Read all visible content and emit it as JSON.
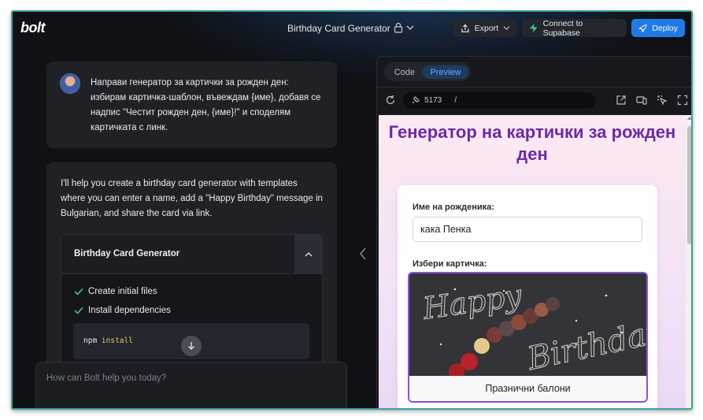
{
  "app": {
    "logo": "bolt",
    "project_title": "Birthday Card Generator"
  },
  "toolbar": {
    "export_label": "Export",
    "supabase_label": "Connect to Supabase",
    "deploy_label": "Deploy"
  },
  "chat": {
    "user_message": "Направи генератор за картички за рожден ден: избирам картичка-шаблон, въвеждам {име}, добавя се надпис \"Честит рожден ден, {име}!\" и споделям картичката с линк.",
    "assistant_message": "I'll help you create a birthday card generator with templates where you can enter a name, add a \"Happy Birthday\" message in Bulgarian, and share the card via link.",
    "artifact": {
      "title": "Birthday Card Generator",
      "steps": [
        "Create initial files",
        "Install dependencies"
      ],
      "command": {
        "cmd": "npm",
        "arg": "install"
      }
    },
    "prompt_placeholder": "How can Bolt help you today?"
  },
  "workbench": {
    "tabs": {
      "code": "Code",
      "preview": "Preview"
    },
    "port": "5173",
    "path": "/"
  },
  "preview": {
    "heading": "Генератор на картички за рожден ден",
    "name_label": "Име на рожденика:",
    "name_value": "кака Пенка",
    "choose_label": "Избери картичка:",
    "image_text": {
      "line1": "Happy",
      "line2": "Birthday"
    },
    "template_caption": "Празнични балони"
  },
  "colors": {
    "accent_blue": "#1f7ae8",
    "supabase_green": "#3ecf8e",
    "heading_purple": "#6d2aa8",
    "selected_border": "#8f4fd8",
    "frame_border": "#3aa39a"
  }
}
